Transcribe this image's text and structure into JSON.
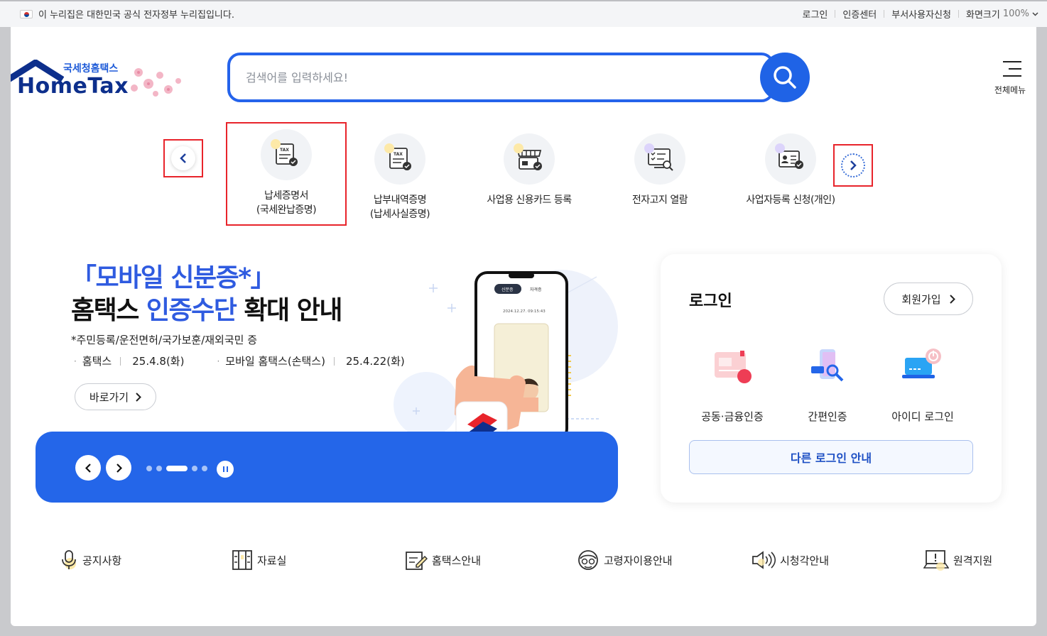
{
  "gov_banner": {
    "text": "이 누리집은 대한민국 공식 전자정부 누리집입니다.",
    "links": [
      "로그인",
      "인증센터",
      "부서사용자신청"
    ],
    "zoom_label": "화면크기",
    "zoom_value": "100%"
  },
  "logo": {
    "sub": "국세청홈택스",
    "main": "HomeTax"
  },
  "search": {
    "placeholder": "검색어를 입력하세요!"
  },
  "all_menu": {
    "label": "전체메뉴"
  },
  "quick_services": [
    {
      "label": "납세증명서\n(국세완납증명)",
      "icon": "tax-certificate-icon",
      "selected": true
    },
    {
      "label": "납부내역증명\n(납세사실증명)",
      "icon": "tax-payment-certificate-icon",
      "selected": false
    },
    {
      "label": "사업용 신용카드 등록",
      "icon": "business-card-icon",
      "selected": false
    },
    {
      "label": "전자고지 열람",
      "icon": "e-notice-icon",
      "selected": false
    },
    {
      "label": "사업자등록 신청(개인)",
      "icon": "business-registration-icon",
      "selected": false
    }
  ],
  "hero": {
    "title_line1": "「모바일 신분증*」",
    "title_line2_a": "홈택스 ",
    "title_line2_b": "인증수단",
    "title_line2_c": " 확대 안내",
    "note": "*주민등록/운전면허/국가보훈/재외국민 증",
    "date1_label": "홈택스",
    "date1_value": "25.4.8(화)",
    "date2_label": "모바일 홈택스(손택스)",
    "date2_value": "25.4.22(화)",
    "goto_label": "바로가기",
    "phone_tab1": "신분증",
    "phone_tab2": "자격증",
    "phone_time": "2024.12.27. 09:15:43",
    "slides_total": 5,
    "slide_active": 3
  },
  "login": {
    "title": "로그인",
    "join_label": "회원가입",
    "options": [
      "공동·금융인증",
      "간편인증",
      "아이디 로그인"
    ],
    "other_label": "다른 로그인 안내"
  },
  "bottom_links": [
    "공지사항",
    "자료실",
    "홈택스안내",
    "고령자이용안내",
    "시청각안내",
    "원격지원"
  ],
  "colors": {
    "primary": "#2466e9",
    "brand_dark": "#0d2f8c",
    "highlight_border": "#e8242b"
  }
}
